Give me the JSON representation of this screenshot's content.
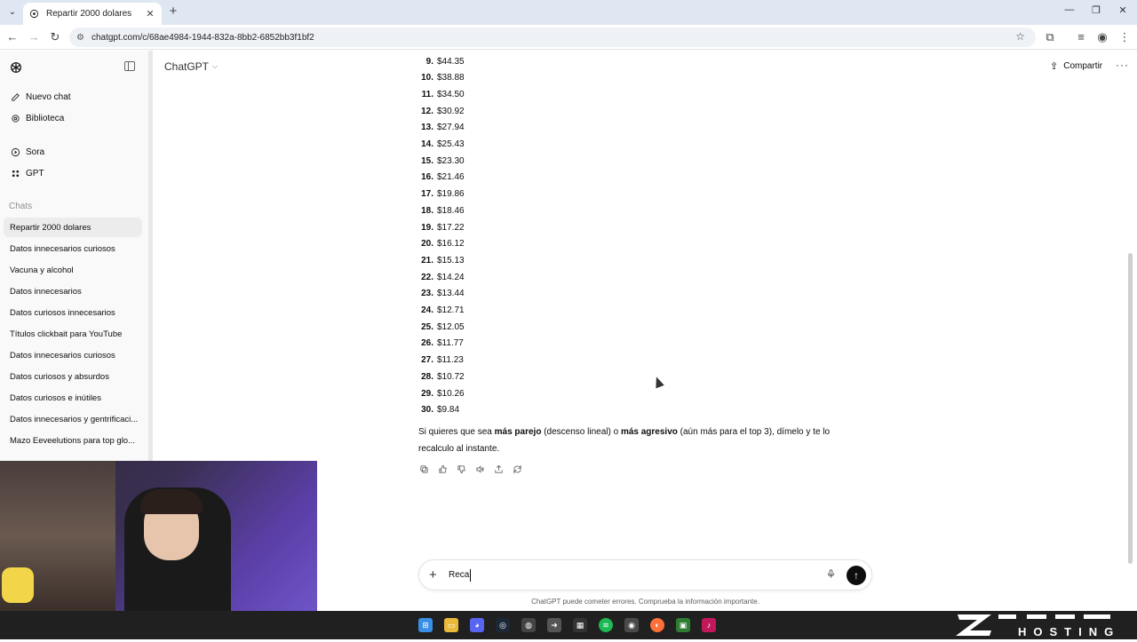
{
  "browser": {
    "tab_title": "Repartir 2000 dolares",
    "url": "chatgpt.com/c/68ae4984-1944-832a-8bb2-6852bb3f1bf2"
  },
  "sidebar": {
    "new_chat": "Nuevo chat",
    "library": "Biblioteca",
    "sora": "Sora",
    "gpt": "GPT",
    "chats_heading": "Chats",
    "chats": [
      "Repartir 2000 dolares",
      "Datos innecesarios curiosos",
      "Vacuna y alcohol",
      "Datos innecesarios",
      "Datos curiosos innecesarios",
      "Títulos clickbait para YouTube",
      "Datos innecesarios curiosos",
      "Datos curiosos y absurdos",
      "Datos curiosos e inútiles",
      "Datos innecesarios y gentrificaci...",
      "Mazo Eeveelutions para top glo..."
    ]
  },
  "header": {
    "title": "ChatGPT",
    "share": "Compartir"
  },
  "list": [
    {
      "n": "9.",
      "v": "$44.35"
    },
    {
      "n": "10.",
      "v": "$38.88"
    },
    {
      "n": "11.",
      "v": "$34.50"
    },
    {
      "n": "12.",
      "v": "$30.92"
    },
    {
      "n": "13.",
      "v": "$27.94"
    },
    {
      "n": "14.",
      "v": "$25.43"
    },
    {
      "n": "15.",
      "v": "$23.30"
    },
    {
      "n": "16.",
      "v": "$21.46"
    },
    {
      "n": "17.",
      "v": "$19.86"
    },
    {
      "n": "18.",
      "v": "$18.46"
    },
    {
      "n": "19.",
      "v": "$17.22"
    },
    {
      "n": "20.",
      "v": "$16.12"
    },
    {
      "n": "21.",
      "v": "$15.13"
    },
    {
      "n": "22.",
      "v": "$14.24"
    },
    {
      "n": "23.",
      "v": "$13.44"
    },
    {
      "n": "24.",
      "v": "$12.71"
    },
    {
      "n": "25.",
      "v": "$12.05"
    },
    {
      "n": "26.",
      "v": "$11.77"
    },
    {
      "n": "27.",
      "v": "$11.23"
    },
    {
      "n": "28.",
      "v": "$10.72"
    },
    {
      "n": "29.",
      "v": "$10.26"
    },
    {
      "n": "30.",
      "v": "$9.84"
    }
  ],
  "followup": {
    "p1": "Si quieres que sea ",
    "b1": "más parejo",
    "p2": " (descenso lineal) o ",
    "b2": "más agresivo",
    "p3": " (aún más para el top 3), dímelo y te lo recalculo al instante."
  },
  "composer": {
    "value": "Reca",
    "disclaimer": "ChatGPT puede cometer errores. Comprueba la información importante."
  },
  "brand_logo": "ZETTA HOSTING",
  "colors": {
    "tab_strip": "#dfe7f3",
    "sidebar_bg": "#f9f9f9",
    "send_button": "#0d0d0d",
    "taskbar": "#202020"
  }
}
